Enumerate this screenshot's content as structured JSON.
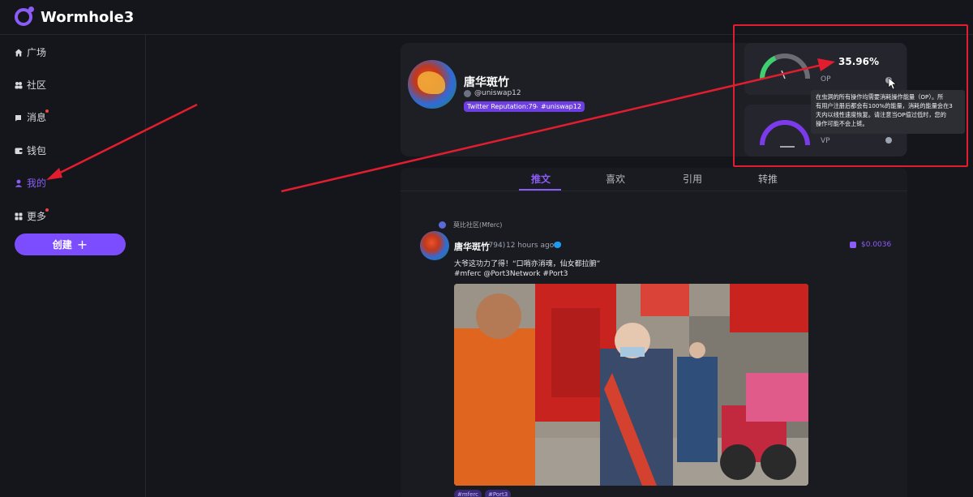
{
  "app": {
    "title": "Wormhole3"
  },
  "sidebar": {
    "items": [
      {
        "label": "广场",
        "icon": "home-icon"
      },
      {
        "label": "社区",
        "icon": "community-icon"
      },
      {
        "label": "消息",
        "icon": "message-icon"
      },
      {
        "label": "钱包",
        "icon": "wallet-icon"
      },
      {
        "label": "我的",
        "icon": "user-icon"
      },
      {
        "label": "更多",
        "icon": "grid-icon"
      }
    ],
    "create_label": "创建",
    "create_plus": "+"
  },
  "profile": {
    "name": "唐华斑竹",
    "handle": "@uniswap12",
    "tags": [
      "Twitter Reputation:794",
      "#uniswap12"
    ]
  },
  "gauges": {
    "op": {
      "label": "OP",
      "value": "35.96%",
      "level": 0.3596
    },
    "vp": {
      "label": "VP"
    }
  },
  "tooltip": {
    "lines": [
      "在虫洞的所有操作均需要消耗操作能量（OP）。所",
      "有用户注册后都会有100%的能量，消耗的能量会在3",
      "天内以线性速度恢复。请注意当OP值过低时，您的",
      "操作可能不会上链。"
    ]
  },
  "tabs": [
    "推文",
    "喜欢",
    "引用",
    "转推"
  ],
  "post": {
    "community": "莫比社区(Mferc)",
    "author": "唐华斑竹",
    "reputation": "(794)",
    "time": "12 hours ago",
    "reward": "$0.0036",
    "text_line1": "大爷这功力了得！“口哨亦消魂，仙女都拉腑”",
    "text_line2": "#mferc @Port3Network #Port3",
    "bottom_tags": [
      "#mferc",
      "#Port3"
    ]
  },
  "colors": {
    "accent": "#8b5cf6",
    "annotation": "#e11d2f",
    "background": "#15161b"
  }
}
